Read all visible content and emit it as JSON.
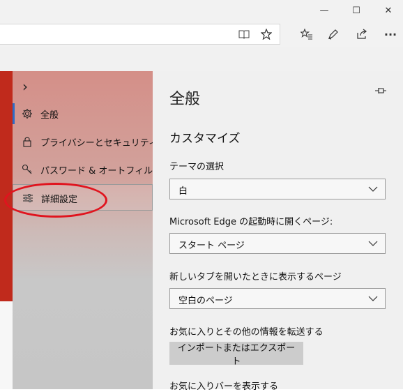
{
  "window": {
    "minimize_glyph": "—",
    "maximize_glyph": "☐",
    "close_glyph": "✕"
  },
  "toolbar": {
    "icons": [
      "reading-view-icon",
      "favorite-star-icon",
      "favorites-hub-icon",
      "pen-icon",
      "share-icon",
      "more-icon"
    ],
    "more_glyph": "···"
  },
  "nav": {
    "chevron": "›",
    "items": [
      {
        "label": "全般",
        "icon": "gear-icon"
      },
      {
        "label": "プライバシーとセキュリティ",
        "icon": "lock-icon"
      },
      {
        "label": "パスワード & オートフィル",
        "icon": "key-icon"
      },
      {
        "label": "詳細設定",
        "icon": "sliders-icon"
      }
    ],
    "active_index": 0,
    "hover_index": 3,
    "annotation_color": "#e0141e"
  },
  "panel": {
    "title": "全般",
    "section": "カスタマイズ",
    "theme": {
      "label": "テーマの選択",
      "value": "白"
    },
    "startup": {
      "label": "Microsoft Edge の起動時に開くページ:",
      "value": "スタート ページ"
    },
    "newtab": {
      "label": "新しいタブを開いたときに表示するページ",
      "value": "空白のページ"
    },
    "transfer": {
      "label": "お気に入りとその他の情報を転送する",
      "button": "インポートまたはエクスポート"
    },
    "favbar": {
      "label": "お気に入りバーを表示する"
    }
  },
  "colors": {
    "active_indicator": "#2d6cc7",
    "web_red": "#c02a1c"
  }
}
